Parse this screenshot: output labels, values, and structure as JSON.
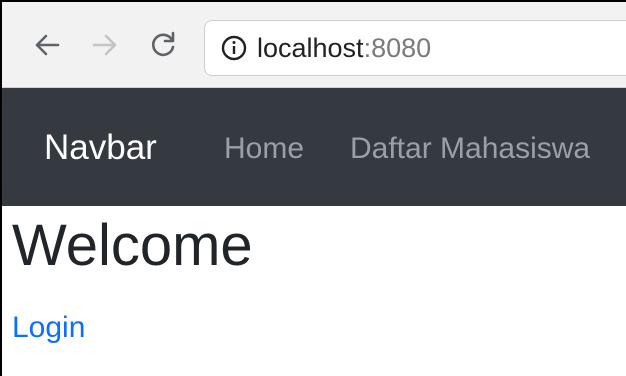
{
  "browser": {
    "url_host": "localhost",
    "url_port": ":8080",
    "icons": {
      "back": "arrow-left-icon",
      "forward": "arrow-right-icon",
      "reload": "reload-icon",
      "info": "info-icon"
    }
  },
  "navbar": {
    "brand": "Navbar",
    "links": [
      {
        "label": "Home"
      },
      {
        "label": "Daftar Mahasiswa"
      }
    ],
    "background_color": "#343a40"
  },
  "main": {
    "heading": "Welcome",
    "login_link": "Login",
    "link_color": "#0d6efd"
  }
}
